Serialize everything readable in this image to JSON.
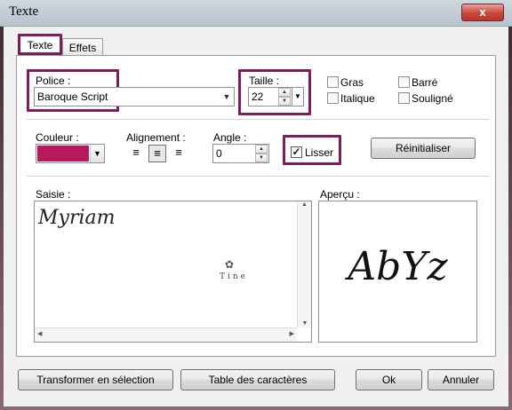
{
  "window": {
    "title": "Texte",
    "close_label": "x"
  },
  "tabs": [
    {
      "label": "Texte"
    },
    {
      "label": "Effets"
    }
  ],
  "font": {
    "label": "Police :",
    "value": "Baroque Script"
  },
  "size": {
    "label": "Taille :",
    "value": "22"
  },
  "styles": {
    "bold": "Gras",
    "italic": "Italique",
    "strike": "Barré",
    "underline": "Souligné"
  },
  "color": {
    "label": "Couleur :",
    "swatch": "#b51a5e"
  },
  "alignment": {
    "label": "Alignement :",
    "options": [
      "left",
      "center",
      "right"
    ],
    "selected": "center"
  },
  "angle": {
    "label": "Angle :",
    "value": "0"
  },
  "smooth": {
    "label": "Lisser",
    "checked": true
  },
  "reset_label": "Réinitialiser",
  "input": {
    "label": "Saisie :",
    "value": "Myriam",
    "watermark": "Tine"
  },
  "preview": {
    "label": "Aperçu :",
    "sample": "AbYz"
  },
  "buttons": {
    "to_selection": "Transformer en sélection",
    "char_table": "Table des caractères",
    "ok": "Ok",
    "cancel": "Annuler"
  },
  "colors": {
    "highlight": "#7b1f5a",
    "accent": "#b51a5e"
  }
}
